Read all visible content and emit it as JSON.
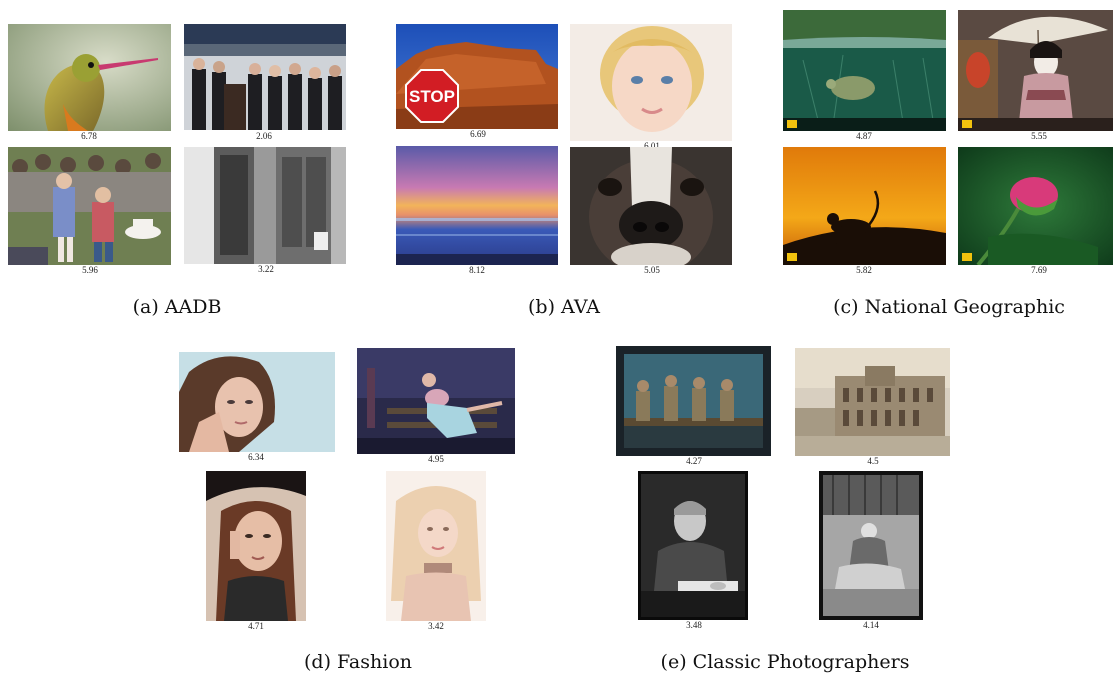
{
  "panels": {
    "aadb": {
      "caption": "(a) AADB",
      "scores": [
        "6.78",
        "2.06",
        "5.96",
        "3.22"
      ],
      "photos": [
        "hummingbird",
        "press conference",
        "children at outdoor concert",
        "black and white doorway"
      ]
    },
    "ava": {
      "caption": "(b) AVA",
      "scores": [
        "6.69",
        "6.01",
        "8.12",
        "5.05"
      ],
      "photos": [
        "stop sign before red rock",
        "blonde child portrait",
        "sunset over ocean",
        "boxer dog face"
      ],
      "stop_sign_text": "STOP"
    },
    "natgeo": {
      "caption": "(c) National Geographic",
      "scores": [
        "4.87",
        "5.55",
        "5.82",
        "7.69"
      ],
      "photos": [
        "turtle in green water",
        "geisha with umbrella",
        "monkey silhouette at sunset",
        "pink flower bud"
      ]
    },
    "fashion": {
      "caption": "(d) Fashion",
      "scores": [
        "6.34",
        "4.95",
        "4.71",
        "3.42"
      ],
      "photos": [
        "model portrait",
        "model on bench",
        "model with hat",
        "blonde model"
      ]
    },
    "classic": {
      "caption": "(e) Classic Photographers",
      "scores": [
        "4.27",
        "4.5",
        "3.48",
        "4.14"
      ],
      "photos": [
        "workers on beam",
        "sepia street buildings",
        "man writing",
        "woman seated outdoors"
      ]
    }
  }
}
